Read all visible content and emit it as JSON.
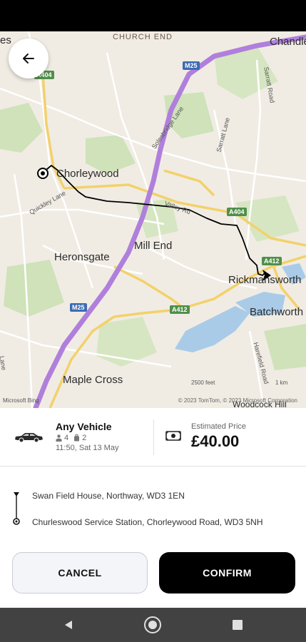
{
  "map": {
    "places": {
      "church_end": "CHURCH END",
      "chandler": "Chandle",
      "es": "es",
      "chorleywood": "Chorleywood",
      "heronsgate": "Heronsgate",
      "mill_end": "Mill End",
      "rickmansworth": "Rickmansworth",
      "batchworth": "Batchworth",
      "maple_cross": "Maple Cross",
      "woodcock_hill": "Woodcock Hill"
    },
    "roads": {
      "m25_top": "M25",
      "m25_bottom": "M25",
      "a404_left": "A404",
      "a404_right": "A404",
      "a412_top": "A412",
      "a412_mid": "A412",
      "solesbridge": "Solesbridge Lane",
      "sarratt": "Sarratt Lane",
      "sarratt_road": "Sarratt Road",
      "quickley": "Quickley Lane",
      "valley": "Valley Rd",
      "harefield": "Harefield Road",
      "lane": "Lane"
    },
    "attribution": "© 2023 TomTom, © 2023 Microsoft Corporation",
    "bing": "Microsoft Bing",
    "scale_miles": "2500 feet",
    "scale_km": "1 km"
  },
  "vehicle": {
    "name": "Any Vehicle",
    "passengers": "4",
    "luggage": "2",
    "datetime": "11:50, Sat 13 May"
  },
  "price": {
    "label": "Estimated Price",
    "value": "£40.00"
  },
  "route": {
    "pickup": "Swan Field House, Northway, WD3 1EN",
    "dropoff": "Churleswood Service Station, Chorleywood Road, WD3 5NH"
  },
  "actions": {
    "cancel": "CANCEL",
    "confirm": "CONFIRM"
  },
  "colors": {
    "motorway": "#b07fdc",
    "route": "#000000",
    "confirm_bg": "#000000"
  }
}
